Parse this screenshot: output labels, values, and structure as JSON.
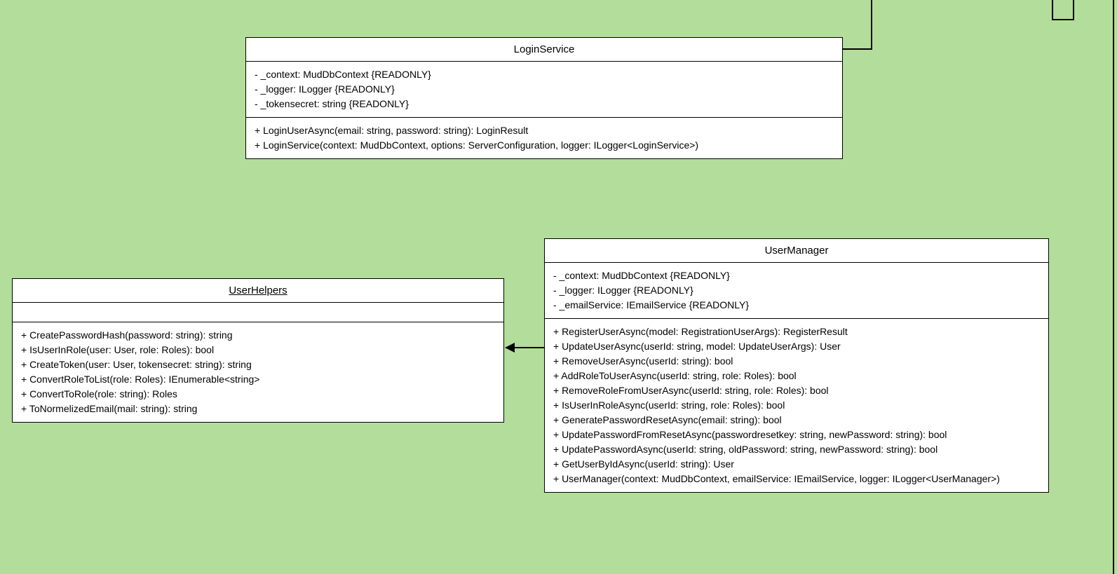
{
  "classes": {
    "loginService": {
      "name": "LoginService",
      "attributes": [
        "- _context: MudDbContext {READONLY}",
        "- _logger: ILogger {READONLY}",
        "- _tokensecret: string {READONLY}"
      ],
      "methods": [
        "+ LoginUserAsync(email: string, password: string): LoginResult",
        "+ LoginService(context: MudDbContext, options: ServerConfiguration, logger: ILogger<LoginService>)"
      ]
    },
    "userHelpers": {
      "name": "UserHelpers",
      "attributes": [],
      "methods": [
        "+ CreatePasswordHash(password: string): string",
        "+ IsUserInRole(user: User, role: Roles): bool",
        "+ CreateToken(user: User, tokensecret: string): string",
        "+ ConvertRoleToList(role: Roles): IEnumerable<string>",
        "+ ConvertToRole(role: string): Roles",
        "+ ToNormelizedEmail(mail: string): string"
      ]
    },
    "userManager": {
      "name": "UserManager",
      "attributes": [
        "- _context: MudDbContext {READONLY}",
        "- _logger: ILogger {READONLY}",
        "- _emailService: IEmailService {READONLY}"
      ],
      "methods": [
        "+ RegisterUserAsync(model: RegistrationUserArgs): RegisterResult",
        "+ UpdateUserAsync(userId: string, model: UpdateUserArgs): User",
        "+ RemoveUserAsync(userId: string): bool",
        "+ AddRoleToUserAsync(userId: string, role: Roles): bool",
        "+ RemoveRoleFromUserAsync(userId: string, role: Roles): bool",
        "+ IsUserInRoleAsync(userId: string, role: Roles): bool",
        "+ GeneratePasswordResetAsync(email: string): bool",
        "+ UpdatePasswordFromResetAsync(passwordresetkey: string, newPassword: string): bool",
        "+ UpdatePasswordAsync(userId: string, oldPassword: string, newPassword: string): bool",
        "+ GetUserByIdAsync(userId: string): User",
        "+ UserManager(context: MudDbContext, emailService: IEmailService, logger: ILogger<UserManager>)"
      ]
    }
  }
}
